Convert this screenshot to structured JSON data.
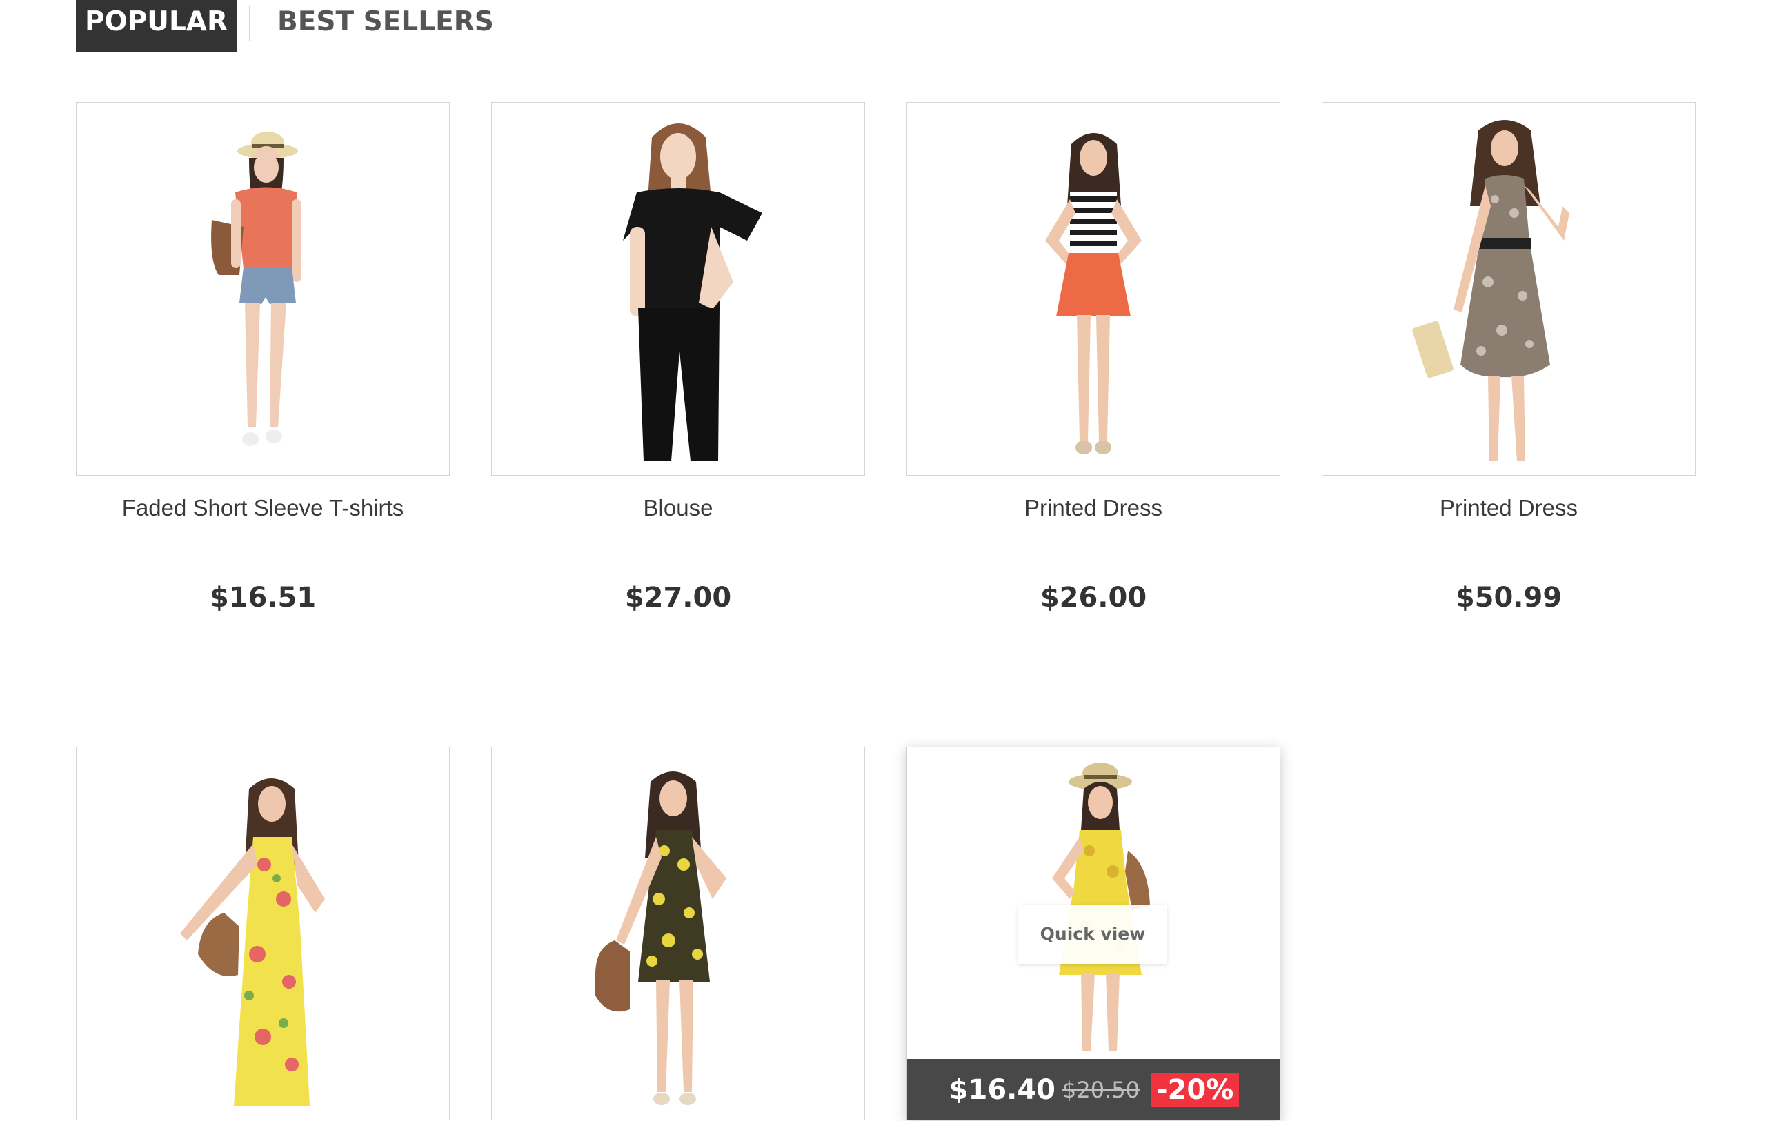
{
  "tabs": [
    {
      "label": "POPULAR",
      "active": true
    },
    {
      "label": "BEST SELLERS",
      "active": false
    }
  ],
  "products": [
    {
      "name": "Faded Short Sleeve T-shirts",
      "price": "$16.51",
      "image": "woman-hat-orange-top-denim-shorts"
    },
    {
      "name": "Blouse",
      "price": "$27.00",
      "image": "woman-black-ruffle-blouse"
    },
    {
      "name": "Printed Dress",
      "price": "$26.00",
      "image": "woman-striped-top-orange-skirt"
    },
    {
      "name": "Printed Dress",
      "price": "$50.99",
      "image": "woman-printed-tiered-dress"
    },
    {
      "name": "",
      "price": "",
      "image": "woman-yellow-floral-maxi-dress"
    },
    {
      "name": "",
      "price": "",
      "image": "woman-dark-yellow-floral-dress"
    },
    {
      "name": "",
      "price": "",
      "image": "woman-hat-yellow-dress",
      "quick_view": "Quick view",
      "sale_price": "$16.40",
      "old_price": "$20.50",
      "discount": "-20%"
    }
  ],
  "colors": {
    "tab_active_bg": "#333333",
    "discount_bg": "#f13340",
    "border": "#d6d4d4"
  }
}
